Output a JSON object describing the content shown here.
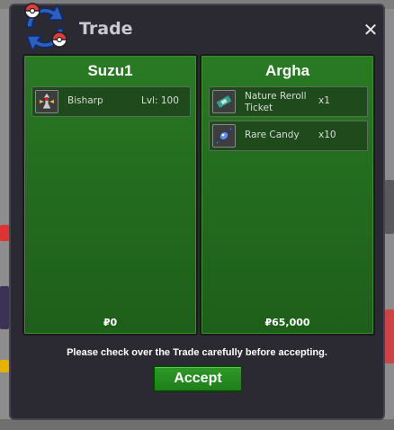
{
  "window": {
    "title": "Trade",
    "close_label": "✕"
  },
  "left_panel": {
    "player_name": "Suzu1",
    "items": [
      {
        "name": "Bisharp",
        "qty": "Lvl: 100",
        "icon": "bisharp-sprite-icon"
      }
    ],
    "money": "₽0"
  },
  "right_panel": {
    "player_name": "Argha",
    "items": [
      {
        "name": "Nature Reroll Ticket",
        "qty": "x1",
        "icon": "ticket-icon"
      },
      {
        "name": "Rare Candy",
        "qty": "x10",
        "icon": "rare-candy-icon"
      }
    ],
    "money": "₽65,000"
  },
  "notice": "Please check over the Trade carefully before accepting.",
  "accept_button": "Accept",
  "colors": {
    "panel_green": "#246d1f",
    "window_bg": "#2b2a33",
    "button_green": "#2a8d22"
  }
}
